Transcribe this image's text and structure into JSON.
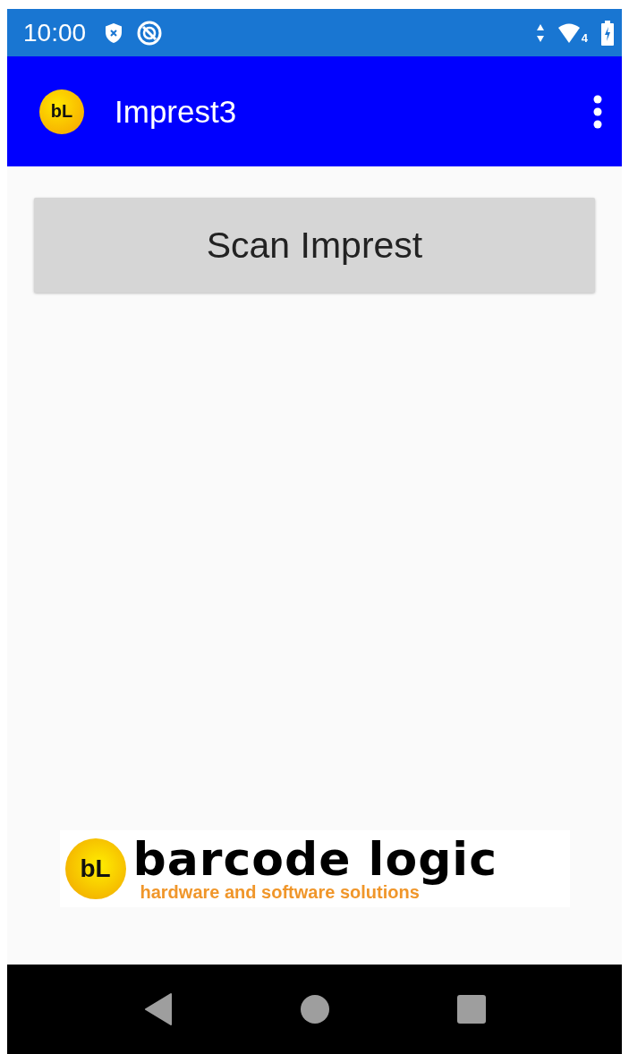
{
  "status_bar": {
    "time": "10:00",
    "network_badge": "4"
  },
  "app_bar": {
    "logo_text": "bL",
    "title": "Imprest3"
  },
  "main": {
    "scan_button": "Scan Imprest"
  },
  "footer_logo": {
    "badge_text": "bL",
    "brand": "barcode logic",
    "tagline": "hardware and software solutions"
  },
  "nav_bar": {
    "buttons": [
      {
        "kind": "back"
      },
      {
        "kind": "home"
      },
      {
        "kind": "recents"
      }
    ]
  }
}
